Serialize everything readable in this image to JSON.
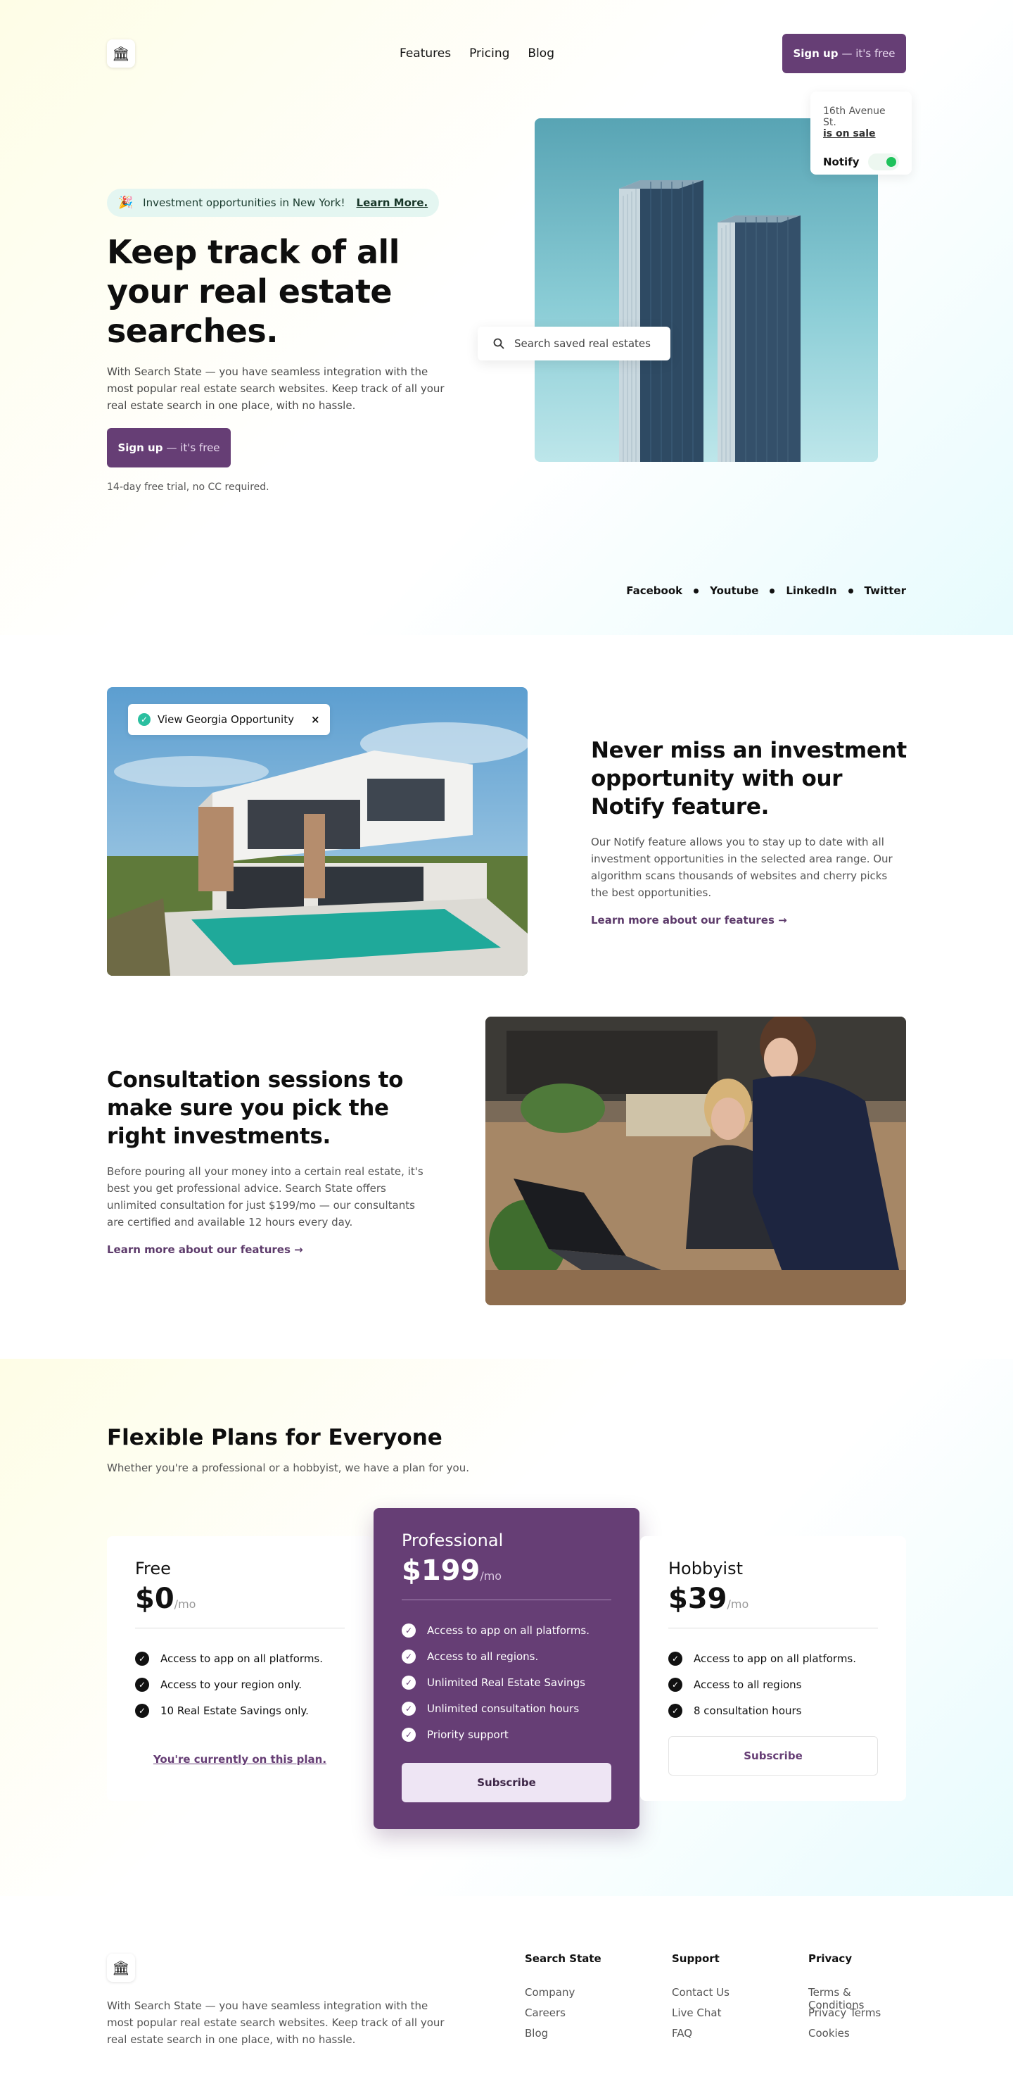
{
  "nav": {
    "logo_icon": "bank-icon",
    "links": [
      "Features",
      "Pricing",
      "Blog"
    ],
    "signup_strong": "Sign up",
    "signup_muted": "— it's free"
  },
  "hero": {
    "pill_emoji": "🎉",
    "pill_text": "Investment opportunities in New York!",
    "pill_link": "Learn More.",
    "title": "Keep track of all your real estate searches.",
    "description": "With Search State — you have seamless integration with the most popular real estate search websites. Keep track of all your real estate search in one place, with no hassle.",
    "cta_strong": "Sign up",
    "cta_muted": "— it's free",
    "note": "14-day free trial, no CC required.",
    "notify_address": "16th Avenue St.",
    "notify_status": "is on sale",
    "notify_label": "Notify",
    "notify_on": true,
    "search_placeholder": "Search saved real estates"
  },
  "socials": [
    "Facebook",
    "Youtube",
    "LinkedIn",
    "Twitter"
  ],
  "features": [
    {
      "badge": "View Georgia Opportunity",
      "title": "Never miss an investment opportunity with our Notify feature.",
      "description": "Our Notify feature allows you to stay up to date with all investment opportunities in the selected area range. Our algorithm scans thousands of websites and cherry picks the best opportunities.",
      "link": "Learn more about our features →"
    },
    {
      "title": "Consultation sessions to make sure you pick the right investments.",
      "description": "Before pouring all your money into a certain real estate, it's best you get professional advice. Search State offers unlimited consultation for just $199/mo — our consultants are certified and available 12 hours every day.",
      "link": "Learn more about our features →"
    }
  ],
  "pricing": {
    "title": "Flexible Plans for Everyone",
    "subtitle": "Whether you're a professional or a hobbyist, we have a plan for you.",
    "plans": [
      {
        "name": "Free",
        "price": "$0",
        "period": "/mo",
        "features": [
          "Access to app on all platforms.",
          "Access to your region only.",
          "10 Real Estate Savings only."
        ],
        "action": "You're currently on this plan."
      },
      {
        "name": "Professional",
        "price": "$199",
        "period": "/mo",
        "features": [
          "Access to app on all platforms.",
          "Access to all regions.",
          "Unlimited Real Estate Savings",
          "Unlimited consultation hours",
          "Priority support"
        ],
        "action": "Subscribe"
      },
      {
        "name": "Hobbyist",
        "price": "$39",
        "period": "/mo",
        "features": [
          "Access to app on all platforms.",
          "Access to all regions",
          "8 consultation hours"
        ],
        "action": "Subscribe"
      }
    ]
  },
  "footer": {
    "description": "With Search State — you have seamless integration with the most popular real estate search websites. Keep track of all your real estate search in one place, with no hassle.",
    "columns": [
      {
        "title": "Search State",
        "links": [
          "Company",
          "Careers",
          "Blog"
        ]
      },
      {
        "title": "Support",
        "links": [
          "Contact Us",
          "Live Chat",
          "FAQ"
        ]
      },
      {
        "title": "Privacy",
        "links": [
          "Terms & Conditions",
          "Privacy Terms",
          "Cookies"
        ]
      }
    ]
  },
  "colors": {
    "brand": "#663e75",
    "pill_bg": "#e4f6f1",
    "check_green": "#2bbfa0",
    "toggle_green": "#1ec25b"
  }
}
